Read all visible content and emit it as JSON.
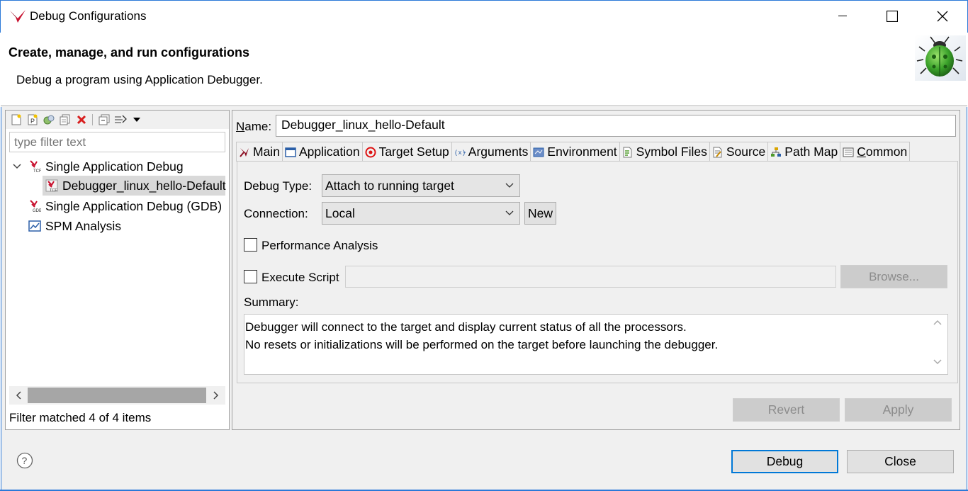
{
  "window": {
    "title": "Debug Configurations",
    "accent": "#2b79d8"
  },
  "header": {
    "title": "Create, manage, and run configurations",
    "description": "Debug a program using Application Debugger.",
    "icon": "bug-icon"
  },
  "left_pane": {
    "toolbar_icons": [
      "new-config-icon",
      "new-prototype-icon",
      "export-icon",
      "duplicate-icon",
      "delete-icon",
      "collapse-all-icon",
      "filter-icon",
      "view-menu-icon"
    ],
    "filter_placeholder": "type filter text",
    "tree": [
      {
        "label": "Single Application Debug",
        "expanded": true,
        "icon": "tcf-icon"
      },
      {
        "label": "Debugger_linux_hello-Default",
        "selected": true,
        "icon": "tcf-config-icon"
      },
      {
        "label": "Single Application Debug (GDB)",
        "icon": "gdb-icon"
      },
      {
        "label": "SPM Analysis",
        "icon": "chart-icon"
      }
    ],
    "status": "Filter matched 4 of 4 items"
  },
  "right_pane": {
    "name_label": "Name:",
    "name_value": "Debugger_linux_hello-Default",
    "tabs": [
      {
        "label": "Main",
        "icon": "xilinx-icon",
        "active": true
      },
      {
        "label": "Application",
        "icon": "window-icon"
      },
      {
        "label": "Target Setup",
        "icon": "target-icon"
      },
      {
        "label": "Arguments",
        "icon": "arguments-icon"
      },
      {
        "label": "Environment",
        "icon": "environment-icon"
      },
      {
        "label": "Symbol Files",
        "icon": "symbol-files-icon"
      },
      {
        "label": "Source",
        "icon": "source-icon"
      },
      {
        "label": "Path Map",
        "icon": "path-map-icon"
      },
      {
        "label": "Common",
        "icon": "common-icon"
      }
    ],
    "debug_type_label": "Debug Type:",
    "debug_type_value": "Attach to running target",
    "connection_label": "Connection:",
    "connection_value": "Local",
    "new_label": "New",
    "perf_label": "Performance Analysis",
    "exec_label": "Execute Script",
    "browse_label": "Browse...",
    "summary_label": "Summary:",
    "summary_line1": "Debugger will connect to the target and display current status of all the processors.",
    "summary_line2": "No resets or initializations will be performed on the target before launching the debugger.",
    "revert_label": "Revert",
    "apply_label": "Apply"
  },
  "footer": {
    "debug_label": "Debug",
    "close_label": "Close"
  }
}
